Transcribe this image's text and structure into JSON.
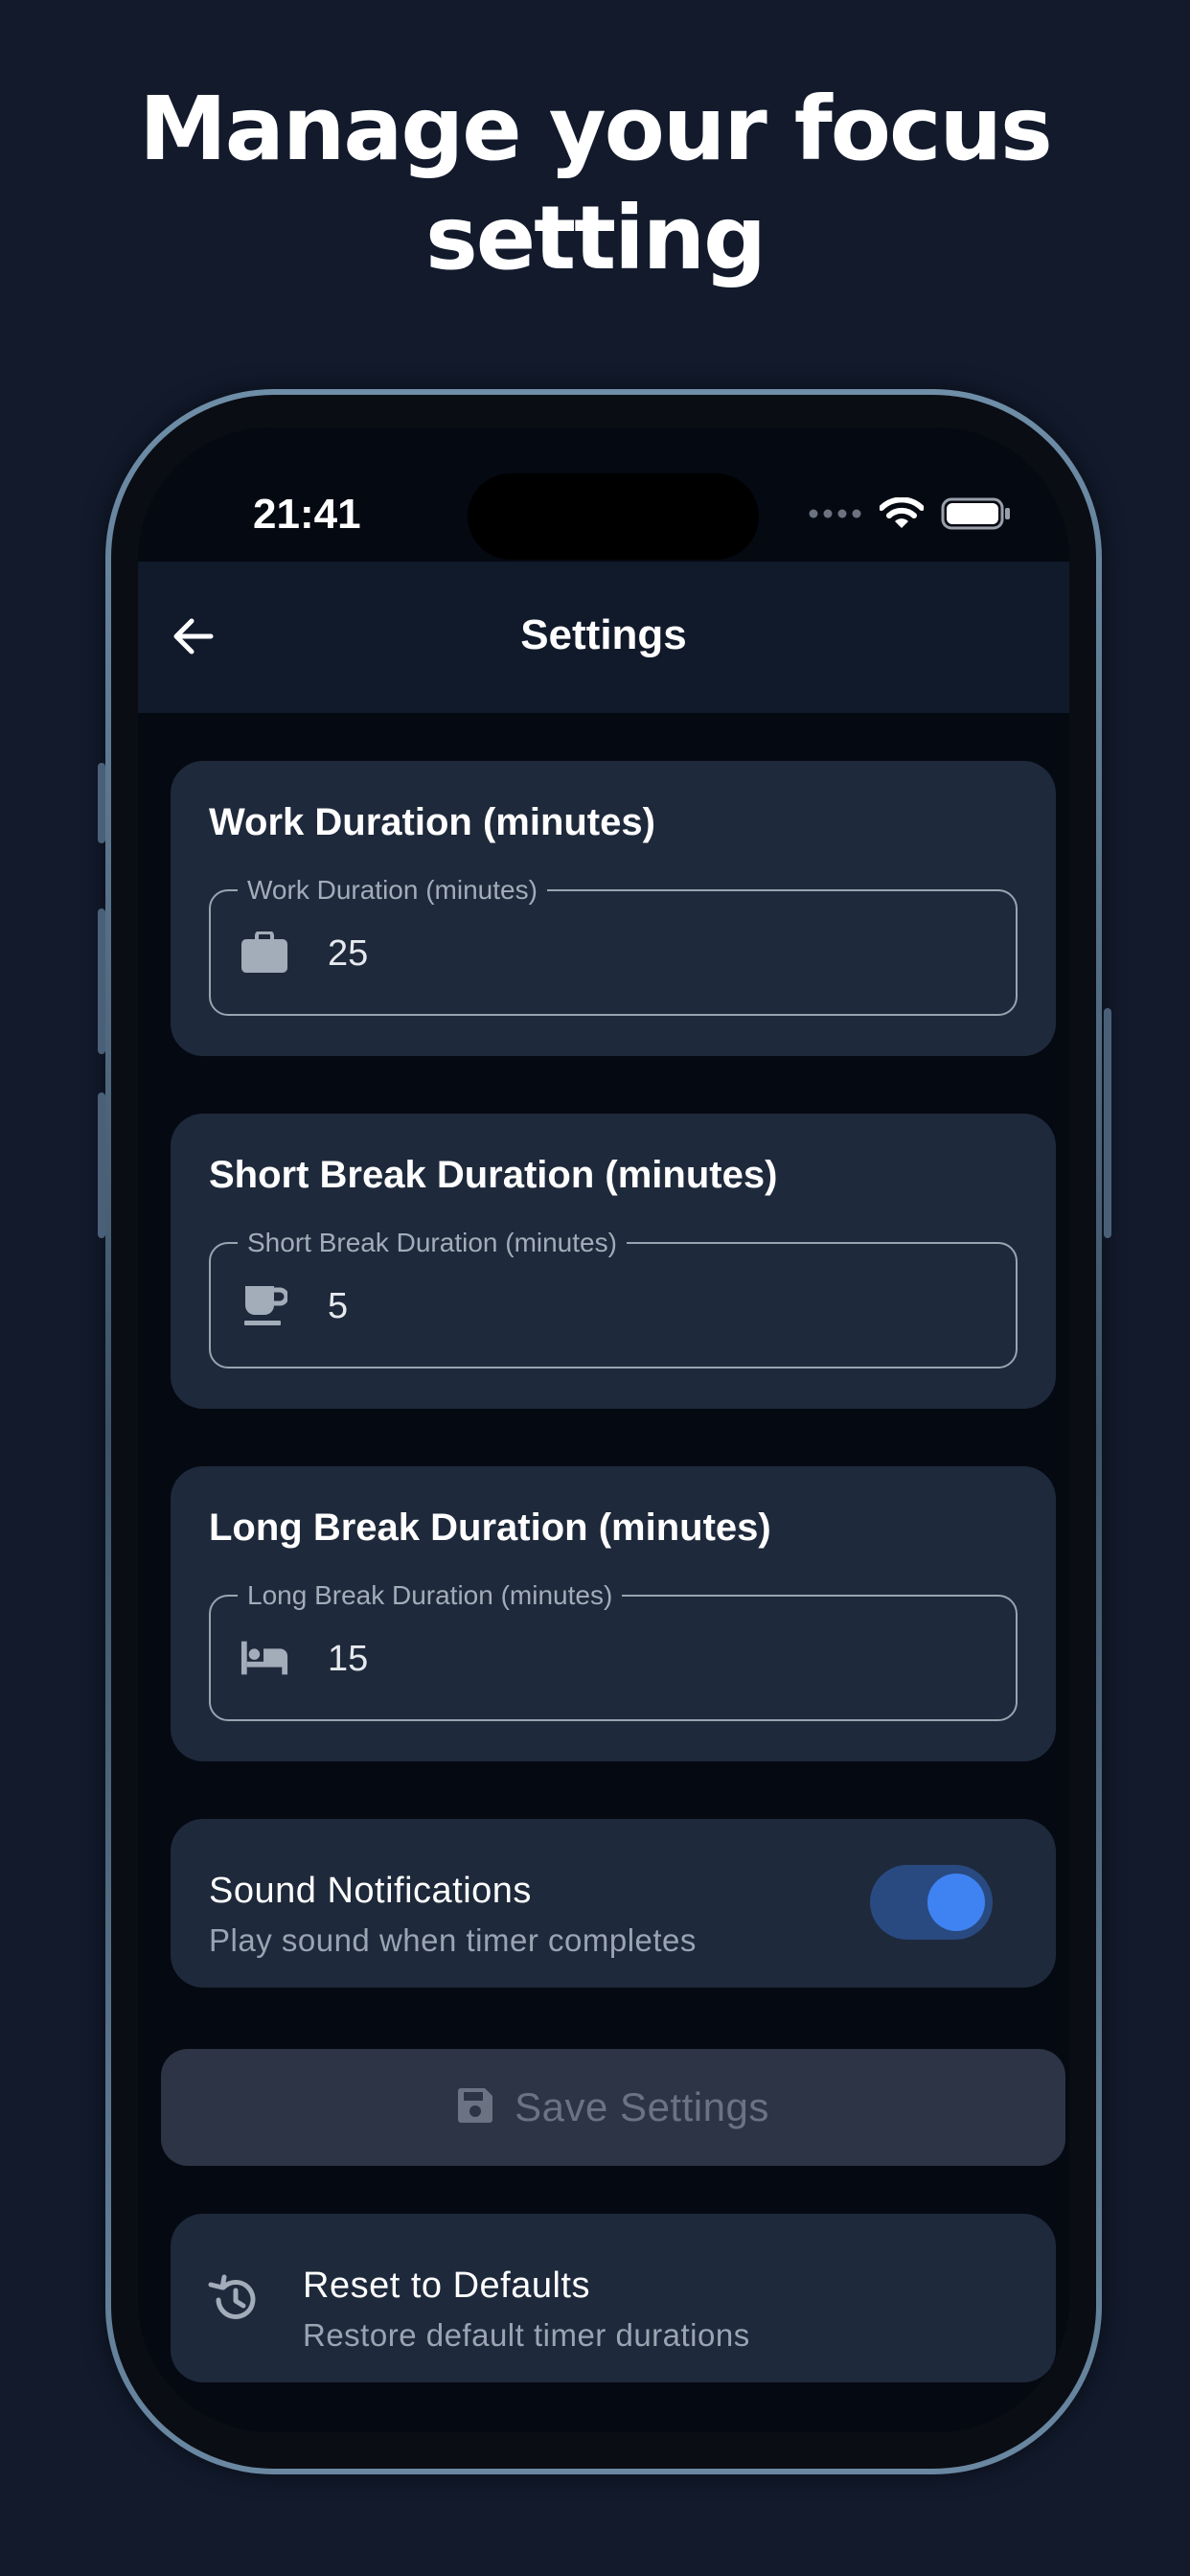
{
  "headline": {
    "line1": "Manage your focus",
    "line2": "setting"
  },
  "status_bar": {
    "time": "21:41",
    "icons": [
      "signal-dots-icon",
      "wifi-icon",
      "battery-icon"
    ]
  },
  "header": {
    "back_icon": "arrow-left-icon",
    "title": "Settings"
  },
  "work_card": {
    "title": "Work Duration (minutes)",
    "field_label": "Work Duration (minutes)",
    "icon": "briefcase-icon",
    "value": "25"
  },
  "short_break_card": {
    "title": "Short Break Duration (minutes)",
    "field_label": "Short Break Duration (minutes)",
    "icon": "coffee-cup-icon",
    "value": "5"
  },
  "long_break_card": {
    "title": "Long Break Duration (minutes)",
    "field_label": "Long Break Duration (minutes)",
    "icon": "bed-icon",
    "value": "15"
  },
  "sound": {
    "title": "Sound Notifications",
    "subtitle": "Play sound when timer completes",
    "enabled": true
  },
  "save": {
    "icon": "floppy-disk-icon",
    "label": "Save Settings"
  },
  "reset": {
    "icon": "history-icon",
    "title": "Reset to Defaults",
    "subtitle": "Restore default timer durations"
  },
  "colors": {
    "page_bg": "#121a2c",
    "card_bg": "#1e293b",
    "toggle_track": "#294a80",
    "toggle_knob": "#3f83f3",
    "save_bg": "#2d3445"
  }
}
